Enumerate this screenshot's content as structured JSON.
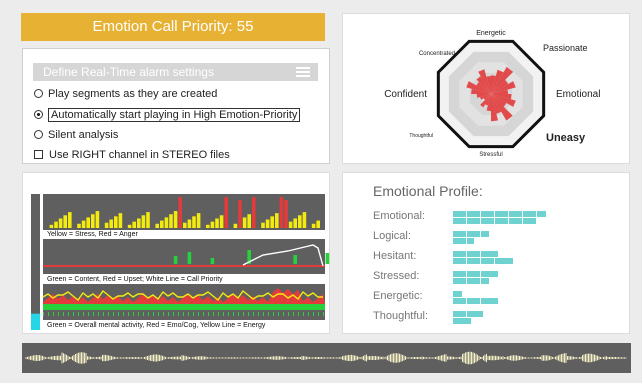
{
  "banner": {
    "text": "Emotion Call Priority: 55"
  },
  "alarm": {
    "header": "Define Real-Time alarm settings",
    "options": [
      {
        "label": "Play segments as they are created",
        "selected": false
      },
      {
        "label": "Automatically start playing in High Emotion-Priority",
        "selected": true
      },
      {
        "label": "Silent analysis",
        "selected": false
      }
    ],
    "checkbox": {
      "label": "Use RIGHT channel in STEREO files",
      "checked": false
    }
  },
  "radar": {
    "labels": [
      "Energetic",
      "Passionate",
      "Emotional",
      "Uneasy",
      "Stressful",
      "Thoughtful",
      "Confident",
      "Concentrated"
    ],
    "values": [
      0.55,
      0.5,
      0.45,
      0.6,
      0.3,
      0.25,
      0.5,
      0.45
    ]
  },
  "graphs": {
    "captions": [
      "Yellow = Stress, Red = Anger",
      "Green = Content, Red = Upset; White Line = Call Priority",
      "Green = Overall mental activity, Red = Emo/Cog, Yellow Line = Energy"
    ],
    "level": 0.12
  },
  "profile": {
    "title": "Emotional Profile:",
    "rows": [
      {
        "label": "Emotional:",
        "values": [
          0.62,
          0.55
        ]
      },
      {
        "label": "Logical:",
        "values": [
          0.24,
          0.14
        ]
      },
      {
        "label": "Hesitant:",
        "values": [
          0.3,
          0.4
        ]
      },
      {
        "label": "Stressed:",
        "values": [
          0.3,
          0.24
        ]
      },
      {
        "label": "Energetic:",
        "values": [
          0.06,
          0.3
        ]
      },
      {
        "label": "Thoughtful:",
        "values": [
          0.2,
          0.12
        ]
      }
    ]
  },
  "colors": {
    "accent": "#e7b234",
    "teal": "#6ed3d0",
    "red": "#e23b3b",
    "yellow": "#f3ea10",
    "green": "#27d13b",
    "cyan": "#27d6e6"
  }
}
